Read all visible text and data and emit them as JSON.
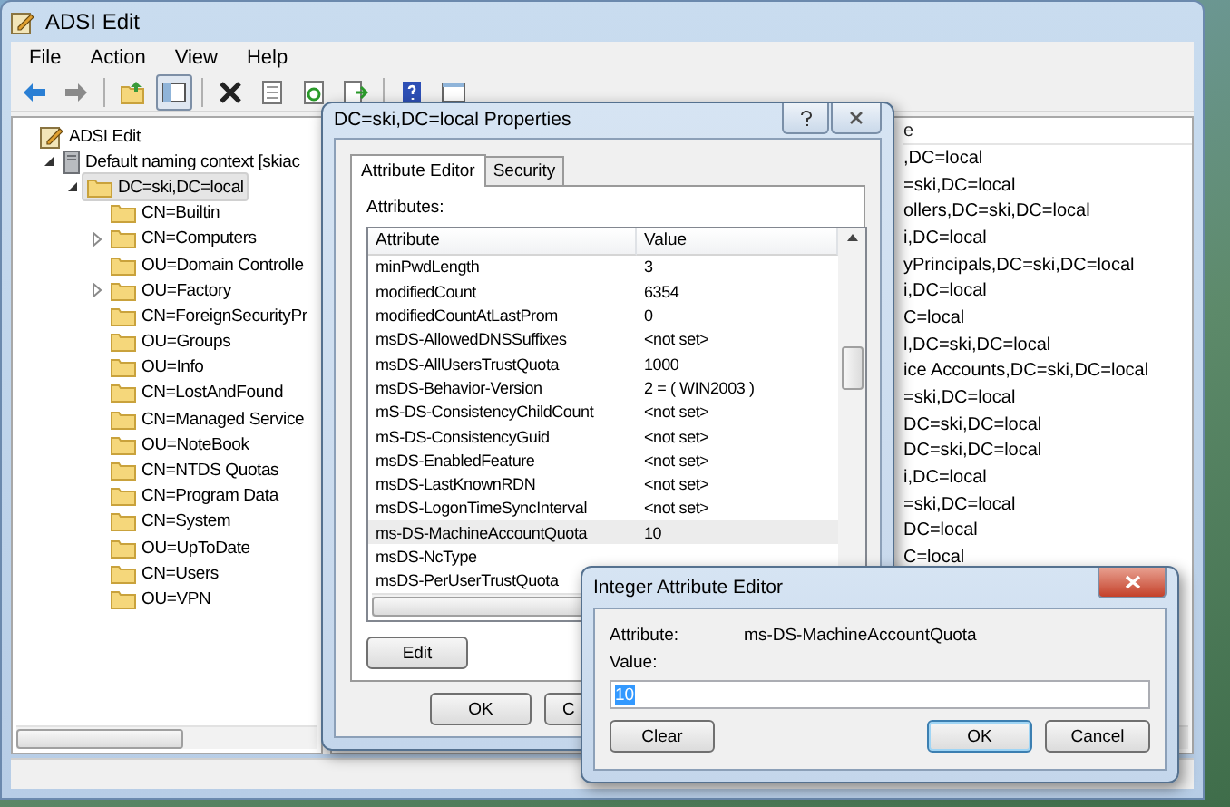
{
  "window": {
    "title": "ADSI Edit"
  },
  "menu": [
    "File",
    "Action",
    "View",
    "Help"
  ],
  "tree": [
    {
      "label": "ADSI Edit",
      "kind": "root",
      "selected": false,
      "children": [
        {
          "label": "Default naming context [skiac",
          "kind": "server",
          "expanded": true,
          "selected": false,
          "children": [
            {
              "label": "DC=ski,DC=local",
              "kind": "folder",
              "expanded": true,
              "selected": true,
              "children": [
                {
                  "label": "CN=Builtin",
                  "kind": "folder",
                  "selected": false
                },
                {
                  "label": "CN=Computers",
                  "kind": "folder",
                  "expanded": false,
                  "selected": false
                },
                {
                  "label": "OU=Domain Controlle",
                  "kind": "folder",
                  "selected": false
                },
                {
                  "label": "OU=Factory",
                  "kind": "folder",
                  "expanded": false,
                  "selected": false
                },
                {
                  "label": "CN=ForeignSecurityPr",
                  "kind": "folder",
                  "selected": false
                },
                {
                  "label": "OU=Groups",
                  "kind": "folder",
                  "selected": false
                },
                {
                  "label": "OU=Info",
                  "kind": "folder",
                  "selected": false
                },
                {
                  "label": "CN=LostAndFound",
                  "kind": "folder",
                  "selected": false
                },
                {
                  "label": "CN=Managed Service",
                  "kind": "folder",
                  "selected": false
                },
                {
                  "label": "OU=NoteBook",
                  "kind": "folder",
                  "selected": false
                },
                {
                  "label": "CN=NTDS Quotas",
                  "kind": "folder",
                  "selected": false
                },
                {
                  "label": "CN=Program Data",
                  "kind": "folder",
                  "selected": false
                },
                {
                  "label": "CN=System",
                  "kind": "folder",
                  "selected": false
                },
                {
                  "label": "OU=UpToDate",
                  "kind": "folder",
                  "selected": false
                },
                {
                  "label": "CN=Users",
                  "kind": "folder",
                  "selected": false
                },
                {
                  "label": "OU=VPN",
                  "kind": "folder",
                  "selected": false
                }
              ]
            }
          ]
        }
      ]
    }
  ],
  "list": {
    "column_1": "e",
    "rows": [
      ",DC=local",
      "=ski,DC=local",
      "ollers,DC=ski,DC=local",
      "i,DC=local",
      "yPrincipals,DC=ski,DC=local",
      "i,DC=local",
      "C=local",
      "l,DC=ski,DC=local",
      "ice Accounts,DC=ski,DC=local",
      "=ski,DC=local",
      "DC=ski,DC=local",
      "DC=ski,DC=local",
      "i,DC=local",
      "=ski,DC=local",
      "DC=local",
      "C=local"
    ]
  },
  "properties_dialog": {
    "title": "DC=ski,DC=local Properties",
    "tabs": [
      {
        "label": "Attribute Editor",
        "selected": true
      },
      {
        "label": "Security",
        "selected": false
      }
    ],
    "attributes_label": "Attributes:",
    "columns": [
      "Attribute",
      "Value"
    ],
    "rows": [
      {
        "attribute": "minPwdLength",
        "value": "3",
        "selected": false
      },
      {
        "attribute": "modifiedCount",
        "value": "6354",
        "selected": false
      },
      {
        "attribute": "modifiedCountAtLastProm",
        "value": "0",
        "selected": false
      },
      {
        "attribute": "msDS-AllowedDNSSuffixes",
        "value": "<not set>",
        "selected": false
      },
      {
        "attribute": "msDS-AllUsersTrustQuota",
        "value": "1000",
        "selected": false
      },
      {
        "attribute": "msDS-Behavior-Version",
        "value": "2 = ( WIN2003 )",
        "selected": false
      },
      {
        "attribute": "mS-DS-ConsistencyChildCount",
        "value": "<not set>",
        "selected": false
      },
      {
        "attribute": "mS-DS-ConsistencyGuid",
        "value": "<not set>",
        "selected": false
      },
      {
        "attribute": "msDS-EnabledFeature",
        "value": "<not set>",
        "selected": false
      },
      {
        "attribute": "msDS-LastKnownRDN",
        "value": "<not set>",
        "selected": false
      },
      {
        "attribute": "msDS-LogonTimeSyncInterval",
        "value": "<not set>",
        "selected": false
      },
      {
        "attribute": "ms-DS-MachineAccountQuota",
        "value": "10",
        "selected": true
      },
      {
        "attribute": "msDS-NcType",
        "selected": false
      },
      {
        "attribute": "msDS-PerUserTrustQuota",
        "selected": false
      }
    ],
    "edit_button": "Edit",
    "ok_button": "OK",
    "cancel_button": "C"
  },
  "integer_dialog": {
    "title": "Integer Attribute Editor",
    "attribute_label": "Attribute:",
    "attribute_value": "ms-DS-MachineAccountQuota",
    "value_label": "Value:",
    "value": "10",
    "value_selected": true,
    "buttons": [
      {
        "label": "Clear",
        "default": false
      },
      {
        "label": "OK",
        "default": true
      },
      {
        "label": "Cancel",
        "default": false
      }
    ]
  }
}
